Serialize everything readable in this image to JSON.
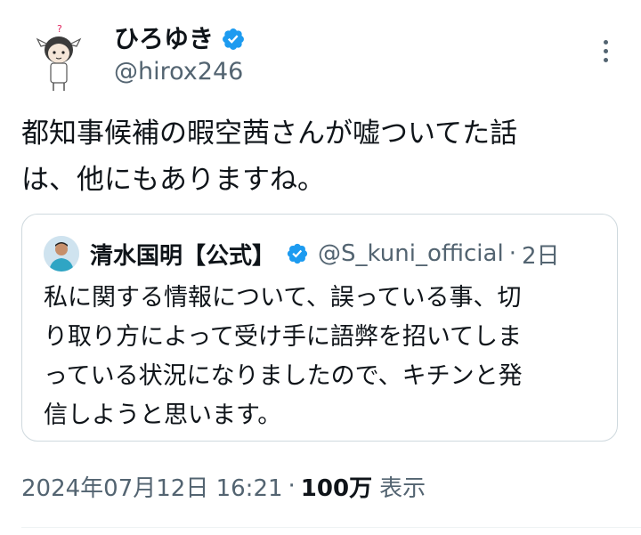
{
  "author": {
    "display_name": "ひろゆき",
    "handle": "@hirox246",
    "verified": true,
    "avatar_icon": "cartoon-avatar-icon",
    "verified_icon": "verified-badge-icon"
  },
  "more_icon": "more-options-icon",
  "tweet": {
    "text": "都知事候補の暇空茜さんが嘘ついてた話\nは、他にもありますね。"
  },
  "quote": {
    "display_name": "清水国明【公式】",
    "handle": "@S_kuni_official",
    "separator": "·",
    "time": "2日",
    "avatar_icon": "profile-photo-icon",
    "verified_icon": "verified-badge-icon",
    "text": "私に関する情報について、誤っている事、切\nり取り方によって受け手に語弊を招いてしま\nっている状況になりましたので、キチンと発\n信しようと思います。"
  },
  "meta": {
    "timestamp": "2024年07月12日 16:21",
    "separator": "·",
    "views_count": "100万",
    "views_label": "表示"
  },
  "colors": {
    "text_primary": "#0f1419",
    "text_secondary": "#536471",
    "verified_blue": "#1d9bf0",
    "border": "#cfd9de"
  }
}
